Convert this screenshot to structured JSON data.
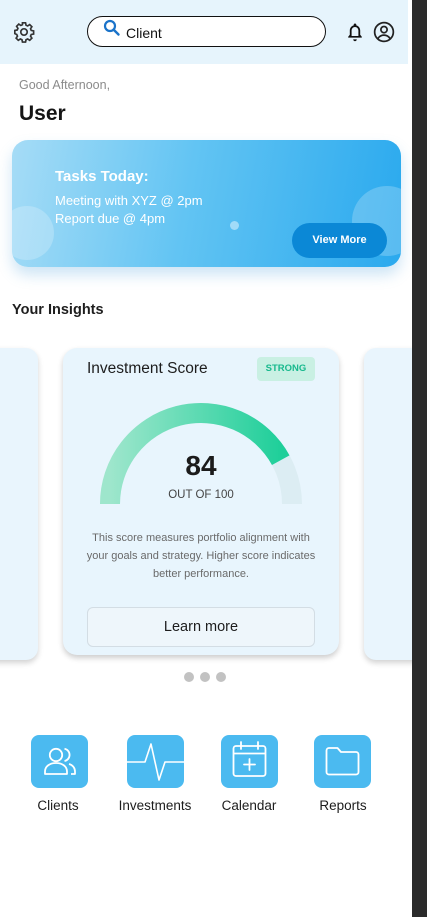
{
  "header": {
    "settings_icon": "gear-icon",
    "search": {
      "value": "Client",
      "icon": "search-icon"
    },
    "notifications_icon": "bell-icon",
    "profile_icon": "user-circle-icon"
  },
  "greeting": {
    "text": "Good Afternoon,",
    "name": "User"
  },
  "tasks_card": {
    "title": "Tasks Today:",
    "items": [
      "Meeting with XYZ  @ 2pm",
      "Report due @ 4pm"
    ],
    "button_label": "View More"
  },
  "insights": {
    "title": "Your Insights",
    "card": {
      "title": "Investment Score",
      "badge": "STRONG",
      "score": "84",
      "score_value": 84,
      "score_max": 100,
      "score_sub": "OUT OF 100",
      "description": "This score measures portfolio alignment with your goals and strategy. Higher score indicates better performance.",
      "button_label": "Learn more"
    },
    "pagination": {
      "count": 3
    }
  },
  "nav": [
    {
      "label": "Clients",
      "icon": "users-icon"
    },
    {
      "label": "Investments",
      "icon": "pulse-icon"
    },
    {
      "label": "Calendar",
      "icon": "calendar-add-icon"
    },
    {
      "label": "Reports",
      "icon": "folder-icon"
    }
  ],
  "colors": {
    "accent": "#4bbaf0",
    "button_dark": "#0b88d6",
    "badge_text": "#18b98d",
    "gauge_start": "#9ee6cc",
    "gauge_end": "#1fcf9a"
  }
}
